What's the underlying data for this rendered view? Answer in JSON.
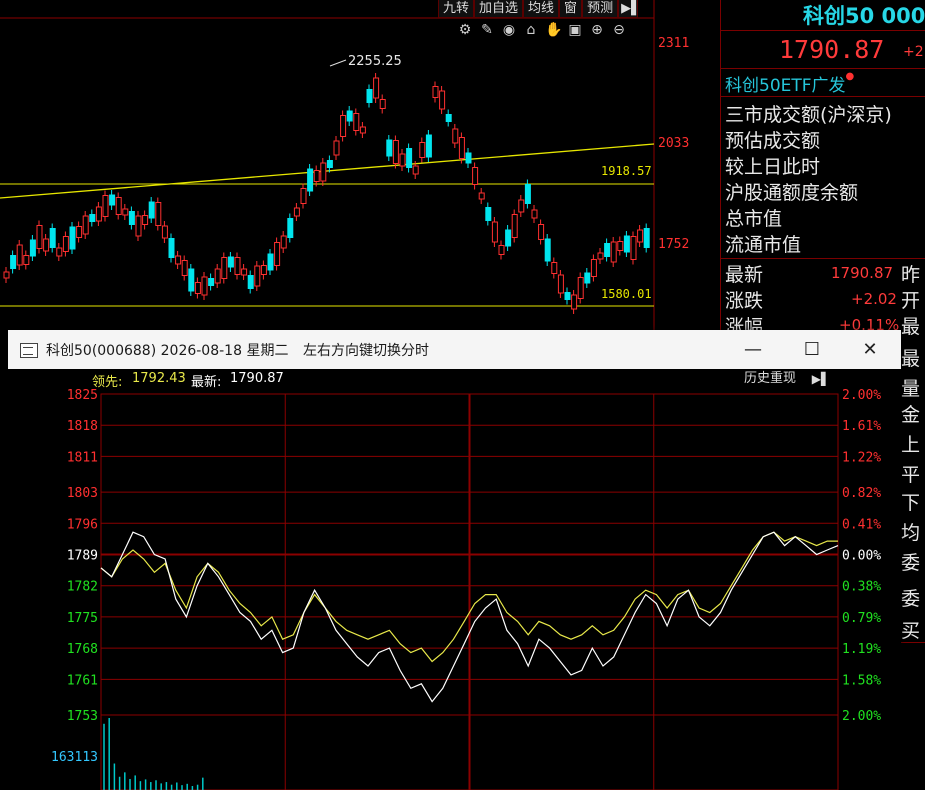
{
  "background_kline": {
    "toolbar_buttons": [
      "九转",
      "加自选",
      "均线",
      "窗",
      "预测"
    ],
    "tool_icons": [
      "gear-icon",
      "pen-icon",
      "eye-icon",
      "store-icon",
      "hand-icon",
      "lock-icon",
      "zoom-in-icon",
      "zoom-out-icon"
    ],
    "high_label": "2255.25",
    "price_axis": [
      "2311",
      "2033",
      "1752"
    ],
    "line_labels": [
      "1918.57",
      "1580.01"
    ],
    "colors": {
      "up": "#ff3030",
      "down": "#00e5ee",
      "trendline": "#e6e600",
      "axis": "#8b0000"
    }
  },
  "quote_panel": {
    "title": "科创50 000",
    "price": "1790.87",
    "change_partial": "+2.",
    "etf_link": "科创50ETF广发",
    "info_lines": [
      "三市成交额(沪深京)",
      "预估成交额",
      "较上日此时",
      "沪股通额度余额",
      "总市值",
      "流通市值"
    ],
    "rows": [
      {
        "label": "最新",
        "value": "1790.87",
        "right": "昨"
      },
      {
        "label": "涨跌",
        "value": "+2.02",
        "right": "开"
      },
      {
        "label": "涨幅",
        "value": "+0.11%",
        "right": "最"
      }
    ],
    "more_labels": [
      "最",
      "量",
      "金",
      "上",
      "平",
      "下",
      "均",
      "委",
      "委",
      "买"
    ]
  },
  "popup": {
    "title": "科创50(000688) 2026-08-18 星期二",
    "hint": "左右方向键切换分时",
    "window_buttons": {
      "minimize": "—",
      "maximize": "☐",
      "close": "✕"
    },
    "lead_label": "领先:",
    "lead_value": "1792.43",
    "latest_label": "最新:",
    "latest_value": "1790.87",
    "history_button": "历史重现",
    "history_arrow": "▶▌",
    "left_axis": [
      "1825",
      "1818",
      "1811",
      "1803",
      "1796",
      "1789",
      "1782",
      "1775",
      "1768",
      "1761",
      "1753"
    ],
    "right_axis": [
      "2.00%",
      "1.61%",
      "1.22%",
      "0.82%",
      "0.41%",
      "0.00%",
      "0.38%",
      "0.79%",
      "1.19%",
      "1.58%",
      "2.00%"
    ],
    "volume_label": "163113",
    "colors": {
      "up": "#ff3030",
      "down": "#20e020",
      "price_line": "#ffffff",
      "lead_line": "#e8e84a",
      "grid": "#8b0000",
      "volume": "#00c8c8"
    }
  },
  "chart_data": [
    {
      "type": "line",
      "title": "科创50(000688) 2026-08-18 星期二",
      "xlabel": "",
      "ylabel": "",
      "ylim": [
        1753,
        1825
      ],
      "grid": true,
      "y_ticks": [
        1825,
        1818,
        1811,
        1803,
        1796,
        1789,
        1782,
        1775,
        1768,
        1761,
        1753
      ],
      "series": [
        {
          "name": "最新",
          "values": [
            1786,
            1784,
            1789,
            1794,
            1793,
            1789,
            1788,
            1779,
            1775,
            1782,
            1787,
            1784,
            1780,
            1776,
            1774,
            1770,
            1772,
            1767,
            1768,
            1776,
            1781,
            1777,
            1772,
            1769,
            1766,
            1764,
            1767,
            1768,
            1763,
            1759,
            1760,
            1756,
            1759,
            1764,
            1769,
            1774,
            1777,
            1779,
            1772,
            1769,
            1764,
            1770,
            1768,
            1765,
            1762,
            1763,
            1768,
            1764,
            1766,
            1771,
            1776,
            1780,
            1778,
            1773,
            1779,
            1781,
            1775,
            1773,
            1776,
            1781,
            1785,
            1789,
            1793,
            1794,
            1791,
            1793,
            1791,
            1789,
            1790,
            1791
          ]
        },
        {
          "name": "领先",
          "values": [
            1786,
            1784,
            1788,
            1790,
            1788,
            1785,
            1787,
            1781,
            1777,
            1784,
            1787,
            1785,
            1781,
            1778,
            1776,
            1773,
            1775,
            1770,
            1771,
            1776,
            1780,
            1777,
            1774,
            1772,
            1771,
            1770,
            1771,
            1772,
            1769,
            1767,
            1768,
            1765,
            1767,
            1770,
            1774,
            1778,
            1780,
            1780,
            1776,
            1774,
            1771,
            1774,
            1773,
            1771,
            1770,
            1771,
            1773,
            1771,
            1772,
            1775,
            1779,
            1781,
            1780,
            1777,
            1780,
            1781,
            1777,
            1776,
            1778,
            1782,
            1786,
            1790,
            1793,
            1794,
            1792,
            1793,
            1792,
            1791,
            1792,
            1792
          ]
        }
      ]
    },
    {
      "type": "bar",
      "title": "",
      "xlabel": "",
      "ylabel": "",
      "ylim": [
        0,
        163113
      ],
      "series": [
        {
          "name": "volume",
          "values": [
            150000,
            163113,
            60000,
            30000,
            40000,
            25000,
            33000,
            20000,
            24000,
            18000,
            22000,
            15000,
            18000,
            12000,
            17000,
            11000,
            14000,
            9000,
            12000,
            28000
          ]
        }
      ]
    }
  ]
}
